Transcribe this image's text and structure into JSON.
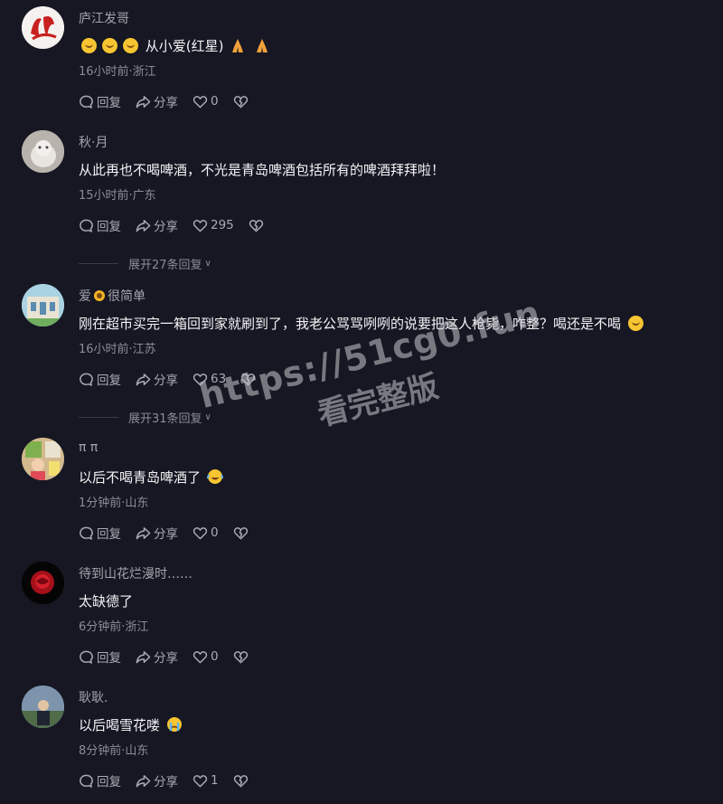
{
  "comments": [
    {
      "name": "庐江发哥",
      "text": "从小爱(红星)",
      "meta": "16小时前·浙江",
      "reply": "回复",
      "share": "分享",
      "likes": "0"
    },
    {
      "name": "秋·月",
      "text": "从此再也不喝啤酒，不光是青岛啤酒包括所有的啤酒拜拜啦！",
      "meta": "15小时前·广东",
      "reply": "回复",
      "share": "分享",
      "likes": "295",
      "expand": "展开27条回复"
    },
    {
      "name": "爱",
      "name_suffix": "很简单",
      "text": "刚在超市买完一箱回到家就刷到了，我老公骂骂咧咧的说要把这人枪毙，咋整？喝还是不喝",
      "meta": "16小时前·江苏",
      "reply": "回复",
      "share": "分享",
      "likes": "63",
      "expand": "展开31条回复"
    },
    {
      "name": "π π",
      "text": "以后不喝青岛啤酒了",
      "meta": "1分钟前·山东",
      "reply": "回复",
      "share": "分享",
      "likes": "0"
    },
    {
      "name": "待到山花烂漫时……",
      "text": "太缺德了",
      "meta": "6分钟前·浙江",
      "reply": "回复",
      "share": "分享",
      "likes": "0"
    },
    {
      "name": "耿耿.",
      "text": "以后喝雪花喽",
      "meta": "8分钟前·山东",
      "reply": "回复",
      "share": "分享",
      "likes": "1"
    }
  ],
  "watermark": {
    "line1": "https://51cg0.fun",
    "line2": "看完整版"
  },
  "icons": [
    "reply-icon",
    "share-icon",
    "heart-icon",
    "broken-heart-icon",
    "smile-emoji-icon",
    "pray-emoji-icon",
    "sunflower-emoji-icon",
    "laugh-cry-emoji-icon",
    "crying-emoji-icon"
  ]
}
